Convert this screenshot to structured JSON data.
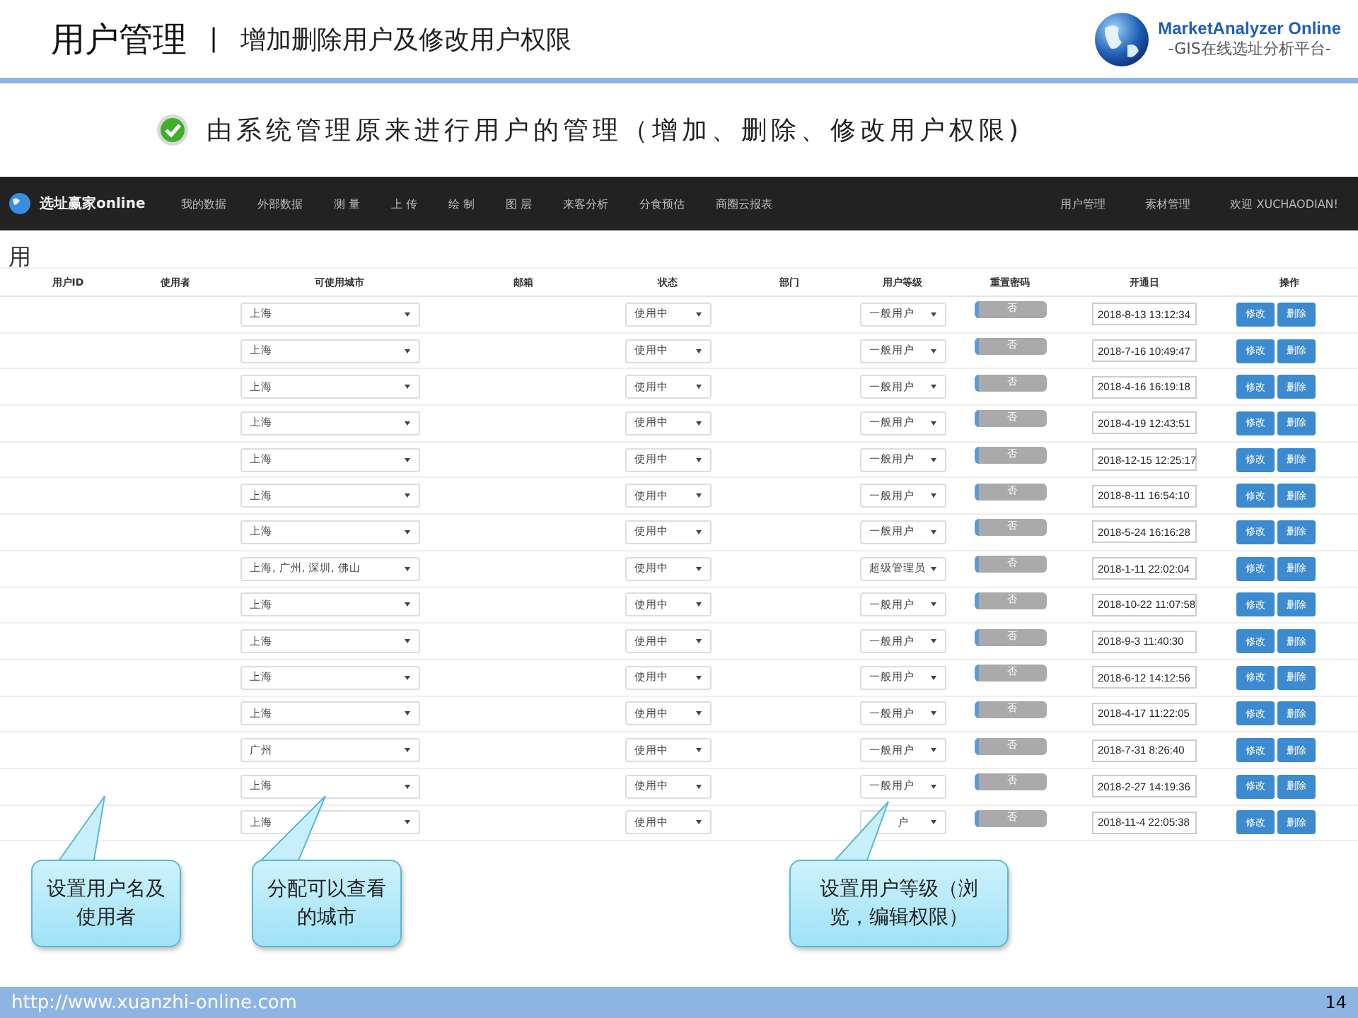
{
  "slide_header": {
    "title": "用户管理",
    "separator": "|",
    "subtitle": "增加删除用户及修改用户权限",
    "logo_title": "MarketAnalyzer Online",
    "logo_subtitle": "-GIS在线选址分析平台-"
  },
  "bullet": "由系统管理原来进行用户的管理（增加、删除、修改用户权限)",
  "app": {
    "brand": "选址赢家online",
    "nav_left": [
      "我的数据",
      "外部数据",
      "测 量",
      "上 传",
      "绘 制",
      "图 层",
      "来客分析",
      "分食预估",
      "商圈云报表"
    ],
    "nav_right": [
      "用户管理",
      "素材管理",
      "欢迎 XUCHAODIAN!"
    ],
    "page_title": "用",
    "columns": [
      "用户ID",
      "使用者",
      "可使用城市",
      "邮箱",
      "状态",
      "部门",
      "用户等级",
      "重置密码",
      "开通日",
      "操作"
    ],
    "rows": [
      {
        "city": "上海",
        "status": "使用中",
        "level": "一般用户",
        "reset": "否",
        "reset_on": false,
        "date": "2018-8-13 13:12:34",
        "edit": "修改",
        "delete": "删除"
      },
      {
        "city": "上海",
        "status": "使用中",
        "level": "一般用户",
        "reset": "否",
        "reset_on": false,
        "date": "2018-7-16 10:49:47",
        "edit": "修改",
        "delete": "删除"
      },
      {
        "city": "上海",
        "status": "使用中",
        "level": "一般用户",
        "reset": "否",
        "reset_on": false,
        "date": "2018-4-16 16:19:18",
        "edit": "修改",
        "delete": "删除"
      },
      {
        "city": "上海",
        "status": "使用中",
        "level": "一般用户",
        "reset": "否",
        "reset_on": false,
        "date": "2018-4-19 12:43:51",
        "edit": "修改",
        "delete": "删除"
      },
      {
        "city": "上海",
        "status": "使用中",
        "level": "一般用户",
        "reset": "否",
        "reset_on": false,
        "date": "2018-12-15 12:25:17",
        "edit": "修改",
        "delete": "删除"
      },
      {
        "city": "上海",
        "status": "使用中",
        "level": "一般用户",
        "reset": "否",
        "reset_on": false,
        "date": "2018-8-11 16:54:10",
        "edit": "修改",
        "delete": "删除"
      },
      {
        "city": "上海",
        "status": "使用中",
        "level": "一般用户",
        "reset": "否",
        "reset_on": false,
        "date": "2018-5-24 16:16:28",
        "edit": "修改",
        "delete": "删除"
      },
      {
        "city": "上海, 广州, 深圳, 佛山",
        "status": "使用中",
        "level": "超级管理员",
        "reset": "否",
        "reset_on": false,
        "date": "2018-1-11 22:02:04",
        "edit": "修改",
        "delete": "删除"
      },
      {
        "city": "上海",
        "status": "使用中",
        "level": "一般用户",
        "reset": "否",
        "reset_on": false,
        "date": "2018-10-22 11:07:58",
        "edit": "修改",
        "delete": "删除"
      },
      {
        "city": "上海",
        "status": "使用中",
        "level": "一般用户",
        "reset": "否",
        "reset_on": false,
        "date": "2018-9-3 11:40:30",
        "edit": "修改",
        "delete": "删除"
      },
      {
        "city": "上海",
        "status": "使用中",
        "level": "一般用户",
        "reset": "否",
        "reset_on": false,
        "date": "2018-6-12 14:12:56",
        "edit": "修改",
        "delete": "删除"
      },
      {
        "city": "上海",
        "status": "使用中",
        "level": "一般用户",
        "reset": "否",
        "reset_on": false,
        "date": "2018-4-17 11:22:05",
        "edit": "修改",
        "delete": "删除"
      },
      {
        "city": "广州",
        "status": "使用中",
        "level": "一般用户",
        "reset": "否",
        "reset_on": false,
        "date": "2018-7-31 8:26:40",
        "edit": "修改",
        "delete": "删除"
      },
      {
        "city": "上海",
        "status": "使用中",
        "level": "一般用户",
        "reset": "否",
        "reset_on": false,
        "date": "2018-2-27 14:19:36",
        "edit": "修改",
        "delete": "删除"
      },
      {
        "city": "上海",
        "status": "使用中",
        "level": "户",
        "reset": "否",
        "reset_on": false,
        "date": "2018-11-4 22:05:38",
        "edit": "修改",
        "delete": "删除"
      }
    ]
  },
  "callouts": [
    "设置用户名及使用者",
    "分配可以查看的城市",
    "设置用户等级（浏览，编辑权限）"
  ],
  "footer": {
    "url": "http://www.xuanzhi-online.com",
    "page": "14"
  }
}
